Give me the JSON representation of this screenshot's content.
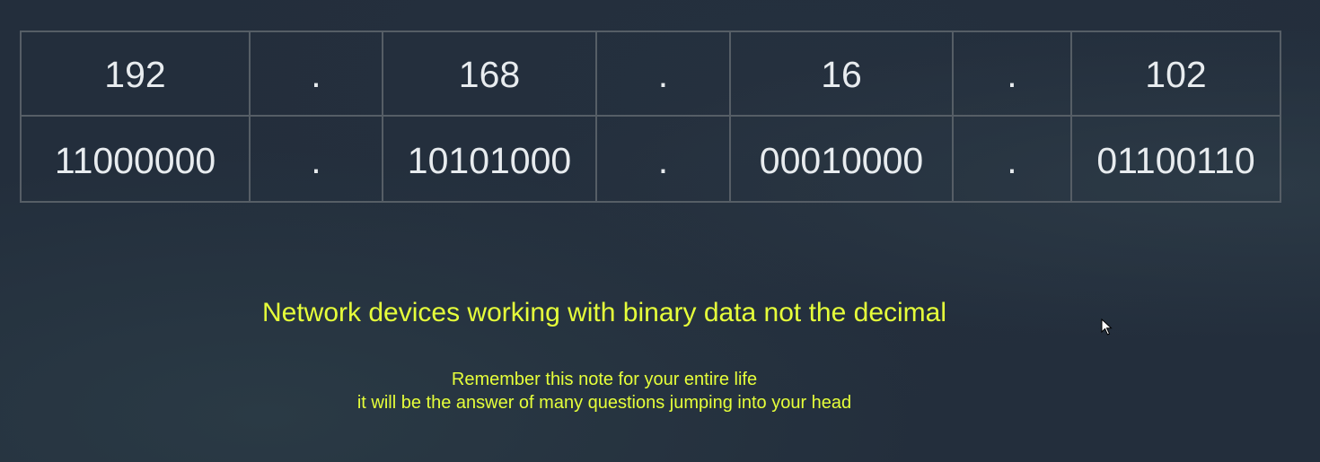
{
  "ip_table": {
    "decimal_row": [
      "192",
      ".",
      "168",
      ".",
      "16",
      ".",
      "102"
    ],
    "binary_row": [
      "11000000",
      ".",
      "10101000",
      ".",
      "00010000",
      ".",
      "01100110"
    ]
  },
  "headline": "Network devices working with binary data not the decimal",
  "note": {
    "line1": "Remember this note for your entire life",
    "line2": "it will be the answer of many questions jumping into your head"
  },
  "colors": {
    "background": "#232e3c",
    "table_text": "#e8ecef",
    "table_border": "#565e66",
    "highlight_text": "#e6ff3a"
  },
  "icons": {
    "cursor": "mouse-pointer-icon"
  }
}
